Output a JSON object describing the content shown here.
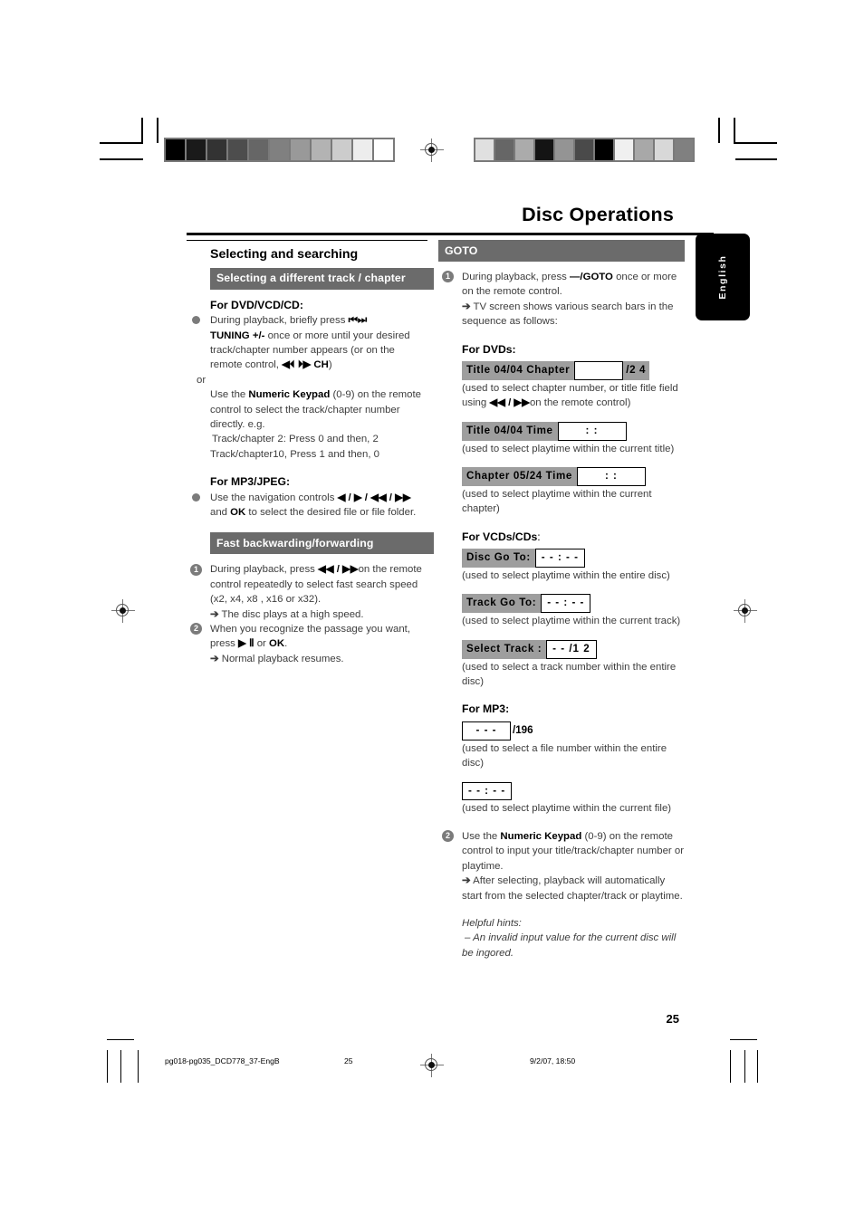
{
  "header": {
    "doc_title": "Disc Operations",
    "language_tab": "English"
  },
  "left_column": {
    "section_title": "Selecting and searching",
    "bar_track_chapter": "Selecting a different track / chapter",
    "subhead_dvd": "For DVD/VCD/CD:",
    "dvd_p1": "During playback, briefly press ",
    "dvd_p1_icons": "⏮⏭",
    "dvd_tuning": "TUNING +/-",
    "dvd_p2": " once or more until your desired track/chapter number appears  (or  on the remote control, ",
    "dvd_p2_icons": "◀⏴ ⏵▶",
    "dvd_ch": "CH",
    "dvd_p2_end": ")",
    "dvd_or": "or",
    "dvd_p3_pre": "Use the ",
    "dvd_keypad": "Numeric Keypad",
    "dvd_p3_post": " (0-9) on the remote control to select the track/chapter number directly. e.g.",
    "dvd_example1": "Track/chapter 2: Press 0 and then, 2",
    "dvd_example2": "Track/chapter10, Press 1 and then, 0",
    "subhead_mp3": "For MP3/JPEG:",
    "mp3_p1_pre": "Use the navigation controls ",
    "mp3_icons": "◀ / ▶ / ◀◀ /   ▶▶",
    "mp3_p1_mid": " and ",
    "mp3_ok": "OK",
    "mp3_p1_post": " to select the desired file or file folder.",
    "bar_fast": "Fast backwarding/forwarding",
    "fast_step1_pre": "During playback, press ",
    "fast_step1_icons": "◀◀ /   ▶▶",
    "fast_step1_post": "on the remote control repeatedly to select fast search speed (x2, x4, x8 , x16 or x32).",
    "fast_result1": "The disc plays at a high speed.",
    "fast_step2_pre": "When you recognize the passage you want, press ",
    "fast_step2_icons": "▶ Ⅱ",
    "fast_step2_mid": " or ",
    "fast_step2_ok": "OK",
    "fast_step2_post": ".",
    "fast_result2": "Normal playback resumes."
  },
  "right_column": {
    "bar_goto": "GOTO",
    "goto_step1_pre": "During playback, press ",
    "goto_key": "—/GOTO",
    "goto_step1_post": " once or more on the remote control.",
    "goto_result1": "TV screen shows various search bars in the sequence as follows:",
    "subhead_dvds": "For DVDs:",
    "osd_dvd_title_chapter": {
      "left": "Title  04/04  Chapter",
      "field": "",
      "right": "/2 4"
    },
    "dvd_note1_pre": "(used to select chapter number, or title fitle field using ",
    "dvd_note1_icons": "◀◀ /   ▶▶",
    "dvd_note1_post": "on the remote control)",
    "osd_dvd_title_time": {
      "left": "Title  04/04  Time",
      "field": ":    :"
    },
    "dvd_note2": "(used to select playtime within the current title)",
    "osd_dvd_chapter_time": {
      "left": "Chapter   05/24   Time",
      "field": ":   :"
    },
    "dvd_note3": "(used to select playtime within the current chapter)",
    "subhead_vcds_bold": "For VCDs/CDs",
    "subhead_vcds_tail": ":",
    "osd_disc_goto": {
      "left": "Disc Go To:",
      "field": "- - : - -"
    },
    "vcd_note1": "(used to select playtime within the entire disc)",
    "osd_track_goto": {
      "left": "Track Go To:",
      "field": "- - : - -"
    },
    "vcd_note2": "(used to select playtime within the current track)",
    "osd_select_track": {
      "left": "Select Track :",
      "field": "- - /1 2"
    },
    "vcd_note3": "(used to select a track number within the entire disc)",
    "subhead_mp3": "For MP3:",
    "osd_mp3_file": {
      "field": "-  -  -",
      "right": "/196"
    },
    "mp3_note1": "(used to select a file number within the entire disc)",
    "osd_mp3_time": {
      "field": "- - : - -"
    },
    "mp3_note2": "(used to select playtime within the current file)",
    "step2_pre": "Use the ",
    "step2_keypad": "Numeric Keypad",
    "step2_post": " (0-9) on the remote control to input your title/track/chapter number or playtime.",
    "step2_result": "After selecting, playback will automatically start from the selected chapter/track or playtime.",
    "hints_title": "Helpful hints:",
    "hints_dash": "–",
    "hints_body": "An invalid input value for the current disc will be ingored."
  },
  "footer": {
    "page_number": "25",
    "file_name": "pg018-pg035_DCD778_37-EngB",
    "folio": "25",
    "timestamp": "9/2/07, 18:50"
  },
  "colors": {
    "bar_grey": "#6b6b6b",
    "osd_grey": "#9e9e9e",
    "body_text": "#3d3d3d",
    "heading_black": "#000000"
  },
  "colorbar_left": [
    "#000000",
    "#1a1a1a",
    "#333333",
    "#4d4d4d",
    "#666666",
    "#808080",
    "#999999",
    "#b3b3b3",
    "#cccccc",
    "#ededed",
    "#ffffff"
  ],
  "colorbar_right": [
    "#e0e0e0",
    "#666666",
    "#ababab",
    "#141414",
    "#949494",
    "#4a4a4a",
    "#000000",
    "#f0f0f0",
    "#a8a8a8",
    "#d8d8d8",
    "#808080"
  ]
}
